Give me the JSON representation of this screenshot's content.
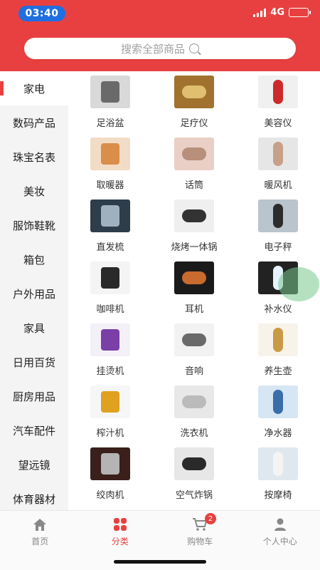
{
  "status": {
    "time": "03:40",
    "network": "4G"
  },
  "search": {
    "placeholder": "搜索全部商品"
  },
  "sidebar": {
    "items": [
      "家电",
      "数码产品",
      "珠宝名表",
      "美妆",
      "服饰鞋靴",
      "箱包",
      "户外用品",
      "家具",
      "日用百货",
      "厨房用品",
      "汽车配件",
      "望远镜",
      "体育器材"
    ],
    "active_index": 0
  },
  "products": [
    {
      "name": "足浴盆",
      "color": "#d9d9d9",
      "accent": "#6a6a6a"
    },
    {
      "name": "足疗仪",
      "color": "#a0722e",
      "accent": "#e0c070"
    },
    {
      "name": "美容仪",
      "color": "#f0f0f0",
      "accent": "#cc2a2a"
    },
    {
      "name": "取暖器",
      "color": "#f3dcc5",
      "accent": "#d98e4a"
    },
    {
      "name": "话筒",
      "color": "#e9cfc5",
      "accent": "#b88f7a"
    },
    {
      "name": "暖风机",
      "color": "#e6e6e6",
      "accent": "#c8a08a"
    },
    {
      "name": "直发梳",
      "color": "#2e3d4a",
      "accent": "#9fb0bf"
    },
    {
      "name": "烧烤一体锅",
      "color": "#efefef",
      "accent": "#333333"
    },
    {
      "name": "电子秤",
      "color": "#b9c4cc",
      "accent": "#2c2c2c"
    },
    {
      "name": "咖啡机",
      "color": "#f4f4f4",
      "accent": "#2a2a2a"
    },
    {
      "name": "耳机",
      "color": "#1a1a1a",
      "accent": "#c96b2e"
    },
    {
      "name": "补水仪",
      "color": "#222222",
      "accent": "#e7f2ff"
    },
    {
      "name": "挂烫机",
      "color": "#f4f0f7",
      "accent": "#7b3fa8"
    },
    {
      "name": "音响",
      "color": "#f2f2f2",
      "accent": "#6a6a6a"
    },
    {
      "name": "养生壶",
      "color": "#f7f3ea",
      "accent": "#c99a45"
    },
    {
      "name": "榨汁机",
      "color": "#f6f6f6",
      "accent": "#e0a020"
    },
    {
      "name": "洗衣机",
      "color": "#e8e8e8",
      "accent": "#bbbbbb"
    },
    {
      "name": "净水器",
      "color": "#d7e6f4",
      "accent": "#3a6ea8"
    },
    {
      "name": "绞肉机",
      "color": "#3a1f1a",
      "accent": "#b4b4b4"
    },
    {
      "name": "空气炸锅",
      "color": "#e7e7e7",
      "accent": "#2a2a2a"
    },
    {
      "name": "按摩椅",
      "color": "#dfe8ee",
      "accent": "#f4f4f4"
    }
  ],
  "tabs": [
    {
      "label": "首页",
      "icon": "home-icon"
    },
    {
      "label": "分类",
      "icon": "category-icon"
    },
    {
      "label": "购物车",
      "icon": "cart-icon",
      "badge": "2"
    },
    {
      "label": "个人中心",
      "icon": "user-icon"
    }
  ],
  "active_tab": 1,
  "colors": {
    "brand": "#e84040",
    "time_pill": "#1f6fe0"
  }
}
